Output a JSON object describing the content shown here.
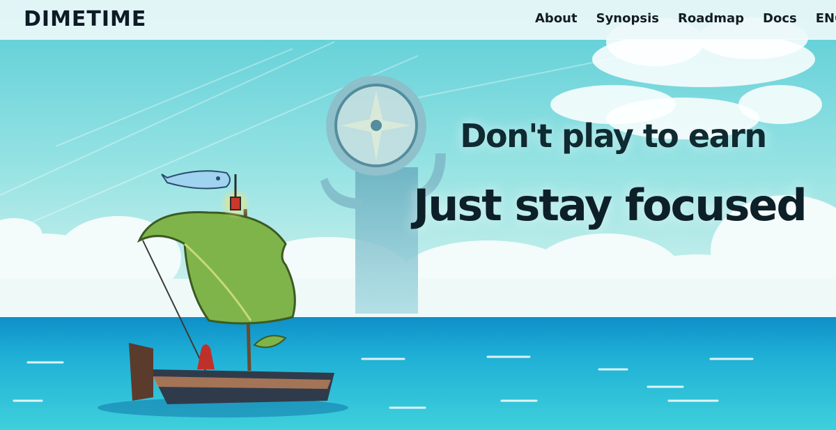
{
  "brand": {
    "logo": "DIMETIME"
  },
  "nav": {
    "items": [
      {
        "label": "About"
      },
      {
        "label": "Synopsis"
      },
      {
        "label": "Roadmap"
      },
      {
        "label": "Docs"
      }
    ],
    "language": {
      "label": "ENG",
      "icon": "chevron-down-icon"
    }
  },
  "hero": {
    "headline": "Don't play to earn",
    "subheadline": "Just stay focused"
  },
  "colors": {
    "sky_top": "#5fd0d8",
    "sea": "#1fa9d2",
    "text_dark": "#0d2028",
    "nav_bg": "#ecf7f9"
  }
}
